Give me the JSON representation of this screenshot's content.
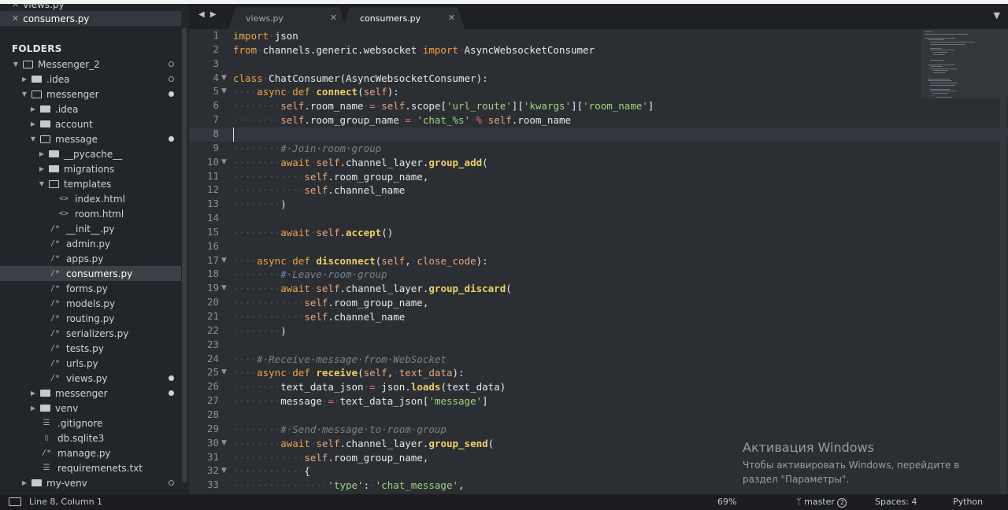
{
  "sidebar": {
    "open_files": [
      {
        "label": "views.py",
        "active": false
      },
      {
        "label": "consumers.py",
        "active": true
      }
    ],
    "folders_heading": "FOLDERS",
    "tree": [
      {
        "label": "Messenger_2",
        "depth": 0,
        "type": "folder",
        "open": true,
        "marker": "ring"
      },
      {
        "label": ".idea",
        "depth": 1,
        "type": "folder",
        "open": false,
        "marker": "ring"
      },
      {
        "label": "messenger",
        "depth": 1,
        "type": "folder",
        "open": true,
        "marker": "dot"
      },
      {
        "label": ".idea",
        "depth": 2,
        "type": "folder",
        "open": false,
        "marker": ""
      },
      {
        "label": "account",
        "depth": 2,
        "type": "folder",
        "open": false,
        "marker": ""
      },
      {
        "label": "message",
        "depth": 2,
        "type": "folder",
        "open": true,
        "marker": "dot"
      },
      {
        "label": "__pycache__",
        "depth": 3,
        "type": "folder",
        "open": false,
        "marker": ""
      },
      {
        "label": "migrations",
        "depth": 3,
        "type": "folder",
        "open": false,
        "marker": ""
      },
      {
        "label": "templates",
        "depth": 3,
        "type": "folder",
        "open": true,
        "marker": ""
      },
      {
        "label": "index.html",
        "depth": 4,
        "type": "file",
        "icon": "<>",
        "marker": ""
      },
      {
        "label": "room.html",
        "depth": 4,
        "type": "file",
        "icon": "<>",
        "marker": ""
      },
      {
        "label": "__init__.py",
        "depth": 3,
        "type": "file",
        "icon": "/*",
        "marker": ""
      },
      {
        "label": "admin.py",
        "depth": 3,
        "type": "file",
        "icon": "/*",
        "marker": ""
      },
      {
        "label": "apps.py",
        "depth": 3,
        "type": "file",
        "icon": "/*",
        "marker": ""
      },
      {
        "label": "consumers.py",
        "depth": 3,
        "type": "file",
        "icon": "/*",
        "marker": "",
        "selected": true
      },
      {
        "label": "forms.py",
        "depth": 3,
        "type": "file",
        "icon": "/*",
        "marker": ""
      },
      {
        "label": "models.py",
        "depth": 3,
        "type": "file",
        "icon": "/*",
        "marker": ""
      },
      {
        "label": "routing.py",
        "depth": 3,
        "type": "file",
        "icon": "/*",
        "marker": ""
      },
      {
        "label": "serializers.py",
        "depth": 3,
        "type": "file",
        "icon": "/*",
        "marker": ""
      },
      {
        "label": "tests.py",
        "depth": 3,
        "type": "file",
        "icon": "/*",
        "marker": ""
      },
      {
        "label": "urls.py",
        "depth": 3,
        "type": "file",
        "icon": "/*",
        "marker": ""
      },
      {
        "label": "views.py",
        "depth": 3,
        "type": "file",
        "icon": "/*",
        "marker": "dot"
      },
      {
        "label": "messenger",
        "depth": 2,
        "type": "folder",
        "open": false,
        "marker": "dot"
      },
      {
        "label": "venv",
        "depth": 2,
        "type": "folder",
        "open": false,
        "marker": ""
      },
      {
        "label": ".gitignore",
        "depth": 2,
        "type": "file",
        "icon": "☰",
        "marker": ""
      },
      {
        "label": "db.sqlite3",
        "depth": 2,
        "type": "file",
        "icon": "▯",
        "marker": ""
      },
      {
        "label": "manage.py",
        "depth": 2,
        "type": "file",
        "icon": "/*",
        "marker": ""
      },
      {
        "label": "requiremenets.txt",
        "depth": 2,
        "type": "file",
        "icon": "☰",
        "marker": ""
      },
      {
        "label": "my-venv",
        "depth": 1,
        "type": "folder",
        "open": false,
        "marker": "ring"
      }
    ]
  },
  "tabs": [
    {
      "label": "views.py",
      "active": false
    },
    {
      "label": "consumers.py",
      "active": true
    }
  ],
  "editor": {
    "fold_lines": [
      4,
      5,
      10,
      17,
      19,
      25,
      30,
      32
    ],
    "lines": [
      {
        "n": 1,
        "tokens": [
          [
            "kw",
            "import"
          ],
          [
            "ws",
            "·"
          ],
          [
            "cl",
            "json"
          ]
        ]
      },
      {
        "n": 2,
        "tokens": [
          [
            "kw",
            "from"
          ],
          [
            "ws",
            "·"
          ],
          [
            "cl",
            "channels.generic.websocket"
          ],
          [
            "ws",
            "·"
          ],
          [
            "kw",
            "import"
          ],
          [
            "ws",
            "·"
          ],
          [
            "cl",
            "AsyncWebsocketConsumer"
          ]
        ]
      },
      {
        "n": 3,
        "tokens": []
      },
      {
        "n": 4,
        "tokens": [
          [
            "kw",
            "class"
          ],
          [
            "ws",
            "·"
          ],
          [
            "cl",
            "ChatConsumer(AsyncWebsocketConsumer):"
          ]
        ]
      },
      {
        "n": 5,
        "tokens": [
          [
            "ws",
            "····"
          ],
          [
            "kw",
            "async"
          ],
          [
            "ws",
            "·"
          ],
          [
            "kw",
            "def"
          ],
          [
            "ws",
            "·"
          ],
          [
            "fn",
            "connect"
          ],
          [
            "cl",
            "("
          ],
          [
            "pa",
            "self"
          ],
          [
            "cl",
            "):"
          ]
        ]
      },
      {
        "n": 6,
        "tokens": [
          [
            "ws",
            "········"
          ],
          [
            "pa",
            "self"
          ],
          [
            "cl",
            ".room_name"
          ],
          [
            "ws",
            "·"
          ],
          [
            "op",
            "="
          ],
          [
            "ws",
            "·"
          ],
          [
            "pa",
            "self"
          ],
          [
            "cl",
            ".scope["
          ],
          [
            "st",
            "'url_route'"
          ],
          [
            "cl",
            "]["
          ],
          [
            "st",
            "'kwargs'"
          ],
          [
            "cl",
            "]["
          ],
          [
            "st",
            "'room_name'"
          ],
          [
            "cl",
            "]"
          ]
        ]
      },
      {
        "n": 7,
        "tokens": [
          [
            "ws",
            "········"
          ],
          [
            "pa",
            "self"
          ],
          [
            "cl",
            ".room_group_name"
          ],
          [
            "ws",
            "·"
          ],
          [
            "op",
            "="
          ],
          [
            "ws",
            "·"
          ],
          [
            "st",
            "'chat_%s'"
          ],
          [
            "ws",
            "·"
          ],
          [
            "op",
            "%"
          ],
          [
            "ws",
            "·"
          ],
          [
            "pa",
            "self"
          ],
          [
            "cl",
            ".room_name"
          ]
        ]
      },
      {
        "n": 8,
        "tokens": []
      },
      {
        "n": 9,
        "tokens": [
          [
            "ws",
            "········"
          ],
          [
            "cm",
            "#·Join·room·group"
          ]
        ]
      },
      {
        "n": 10,
        "tokens": [
          [
            "ws",
            "········"
          ],
          [
            "kw",
            "await"
          ],
          [
            "ws",
            "·"
          ],
          [
            "pa",
            "self"
          ],
          [
            "cl",
            ".channel_layer."
          ],
          [
            "fn",
            "group_add"
          ],
          [
            "cl",
            "("
          ]
        ]
      },
      {
        "n": 11,
        "tokens": [
          [
            "ws",
            "············"
          ],
          [
            "pa",
            "self"
          ],
          [
            "cl",
            ".room_group_name,"
          ]
        ]
      },
      {
        "n": 12,
        "tokens": [
          [
            "ws",
            "············"
          ],
          [
            "pa",
            "self"
          ],
          [
            "cl",
            ".channel_name"
          ]
        ]
      },
      {
        "n": 13,
        "tokens": [
          [
            "ws",
            "········"
          ],
          [
            "cl",
            ")"
          ]
        ]
      },
      {
        "n": 14,
        "tokens": []
      },
      {
        "n": 15,
        "tokens": [
          [
            "ws",
            "········"
          ],
          [
            "kw",
            "await"
          ],
          [
            "ws",
            "·"
          ],
          [
            "pa",
            "self"
          ],
          [
            "cl",
            "."
          ],
          [
            "fn",
            "accept"
          ],
          [
            "cl",
            "()"
          ]
        ]
      },
      {
        "n": 16,
        "tokens": []
      },
      {
        "n": 17,
        "tokens": [
          [
            "ws",
            "····"
          ],
          [
            "kw",
            "async"
          ],
          [
            "ws",
            "·"
          ],
          [
            "kw",
            "def"
          ],
          [
            "ws",
            "·"
          ],
          [
            "fn",
            "disconnect"
          ],
          [
            "cl",
            "("
          ],
          [
            "pa",
            "self"
          ],
          [
            "cl",
            ","
          ],
          [
            "ws",
            "·"
          ],
          [
            "pa",
            "close_code"
          ],
          [
            "cl",
            "):"
          ]
        ]
      },
      {
        "n": 18,
        "tokens": [
          [
            "ws",
            "········"
          ],
          [
            "cm",
            "#·Leave·room·group"
          ]
        ]
      },
      {
        "n": 19,
        "tokens": [
          [
            "ws",
            "········"
          ],
          [
            "kw",
            "await"
          ],
          [
            "ws",
            "·"
          ],
          [
            "pa",
            "self"
          ],
          [
            "cl",
            ".channel_layer."
          ],
          [
            "fn",
            "group_discard"
          ],
          [
            "cl",
            "("
          ]
        ]
      },
      {
        "n": 20,
        "tokens": [
          [
            "ws",
            "············"
          ],
          [
            "pa",
            "self"
          ],
          [
            "cl",
            ".room_group_name,"
          ]
        ]
      },
      {
        "n": 21,
        "tokens": [
          [
            "ws",
            "············"
          ],
          [
            "pa",
            "self"
          ],
          [
            "cl",
            ".channel_name"
          ]
        ]
      },
      {
        "n": 22,
        "tokens": [
          [
            "ws",
            "········"
          ],
          [
            "cl",
            ")"
          ]
        ]
      },
      {
        "n": 23,
        "tokens": []
      },
      {
        "n": 24,
        "tokens": [
          [
            "ws",
            "····"
          ],
          [
            "cm",
            "#·Receive·message·from·WebSocket"
          ]
        ]
      },
      {
        "n": 25,
        "tokens": [
          [
            "ws",
            "····"
          ],
          [
            "kw",
            "async"
          ],
          [
            "ws",
            "·"
          ],
          [
            "kw",
            "def"
          ],
          [
            "ws",
            "·"
          ],
          [
            "fn",
            "receive"
          ],
          [
            "cl",
            "("
          ],
          [
            "pa",
            "self"
          ],
          [
            "cl",
            ","
          ],
          [
            "ws",
            "·"
          ],
          [
            "pa",
            "text_data"
          ],
          [
            "cl",
            "):"
          ]
        ]
      },
      {
        "n": 26,
        "tokens": [
          [
            "ws",
            "········"
          ],
          [
            "cl",
            "text_data_json"
          ],
          [
            "ws",
            "·"
          ],
          [
            "op",
            "="
          ],
          [
            "ws",
            "·"
          ],
          [
            "cl",
            "json."
          ],
          [
            "fn",
            "loads"
          ],
          [
            "cl",
            "(text_data)"
          ]
        ]
      },
      {
        "n": 27,
        "tokens": [
          [
            "ws",
            "········"
          ],
          [
            "cl",
            "message"
          ],
          [
            "ws",
            "·"
          ],
          [
            "op",
            "="
          ],
          [
            "ws",
            "·"
          ],
          [
            "cl",
            "text_data_json["
          ],
          [
            "st",
            "'message'"
          ],
          [
            "cl",
            "]"
          ]
        ]
      },
      {
        "n": 28,
        "tokens": []
      },
      {
        "n": 29,
        "tokens": [
          [
            "ws",
            "········"
          ],
          [
            "cm",
            "#·Send·message·to·room·group"
          ]
        ]
      },
      {
        "n": 30,
        "tokens": [
          [
            "ws",
            "········"
          ],
          [
            "kw",
            "await"
          ],
          [
            "ws",
            "·"
          ],
          [
            "pa",
            "self"
          ],
          [
            "cl",
            ".channel_layer."
          ],
          [
            "fn",
            "group_send"
          ],
          [
            "cl",
            "("
          ]
        ]
      },
      {
        "n": 31,
        "tokens": [
          [
            "ws",
            "············"
          ],
          [
            "pa",
            "self"
          ],
          [
            "cl",
            ".room_group_name,"
          ]
        ]
      },
      {
        "n": 32,
        "tokens": [
          [
            "ws",
            "············"
          ],
          [
            "cl",
            "{"
          ]
        ]
      },
      {
        "n": 33,
        "tokens": [
          [
            "ws",
            "················"
          ],
          [
            "st",
            "'type'"
          ],
          [
            "cl",
            ":"
          ],
          [
            "ws",
            "·"
          ],
          [
            "st",
            "'chat_message'"
          ],
          [
            "cl",
            ","
          ]
        ]
      }
    ]
  },
  "activation": {
    "title": "Активация Windows",
    "subtitle": "Чтобы активировать Windows, перейдите в раздел \"Параметры\"."
  },
  "status": {
    "position": "Line 8, Column 1",
    "zoom": "69%",
    "branch": "master",
    "branch_count": "2",
    "spaces": "Spaces: 4",
    "syntax": "Python"
  }
}
